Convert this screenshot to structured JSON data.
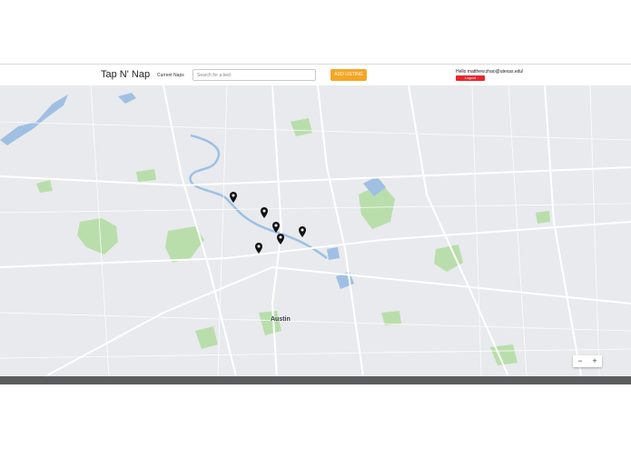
{
  "header": {
    "brand": "Tap N' Nap",
    "nav_current_naps": "Current Naps",
    "search_placeholder": "Search for a bed",
    "add_listing": "ADD LISTING",
    "greeting": "Hello matthew.zhao@utexas.edu!",
    "logout": "Logout"
  },
  "map": {
    "city_label": "Austin",
    "zoom_out": "−",
    "zoom_in": "+",
    "pin_count": 6,
    "colors": {
      "water": "#9fc0e2",
      "park": "#b9deab",
      "land": "#e8eaed",
      "road": "#ffffff",
      "pin": "#111111"
    }
  }
}
